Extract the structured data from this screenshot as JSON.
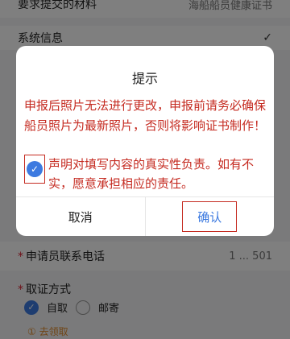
{
  "background": {
    "row1_label": "要求提交的材料",
    "row1_value": "海船船员健康证书",
    "system_info_label": "系统信息",
    "system_info_check": "✓",
    "phone_label": "申请员联系电话",
    "phone_value": "1 ... 501",
    "pickup_label": "取证方式",
    "pickup_options": [
      {
        "label": "自取",
        "selected": true
      },
      {
        "label": "邮寄",
        "selected": false
      }
    ],
    "hint": "① 去领取"
  },
  "dialog": {
    "title": "提示",
    "warning": "申报后照片无法进行更改，申报前请务必确保船员照片为最新照片，否则将影响证书制作！",
    "agree_text": "声明对填写内容的真实性负责。如有不实，愿意承担相应的责任。",
    "agree_checked": true,
    "cancel_label": "取消",
    "confirm_label": "确认"
  },
  "colors": {
    "warning_red": "#c52b21",
    "accent_blue": "#3d7ae0",
    "overlay": "rgba(0,0,0,0.5)"
  },
  "icons": {
    "checkbox": "check-icon",
    "radio_selected": "check-icon"
  }
}
